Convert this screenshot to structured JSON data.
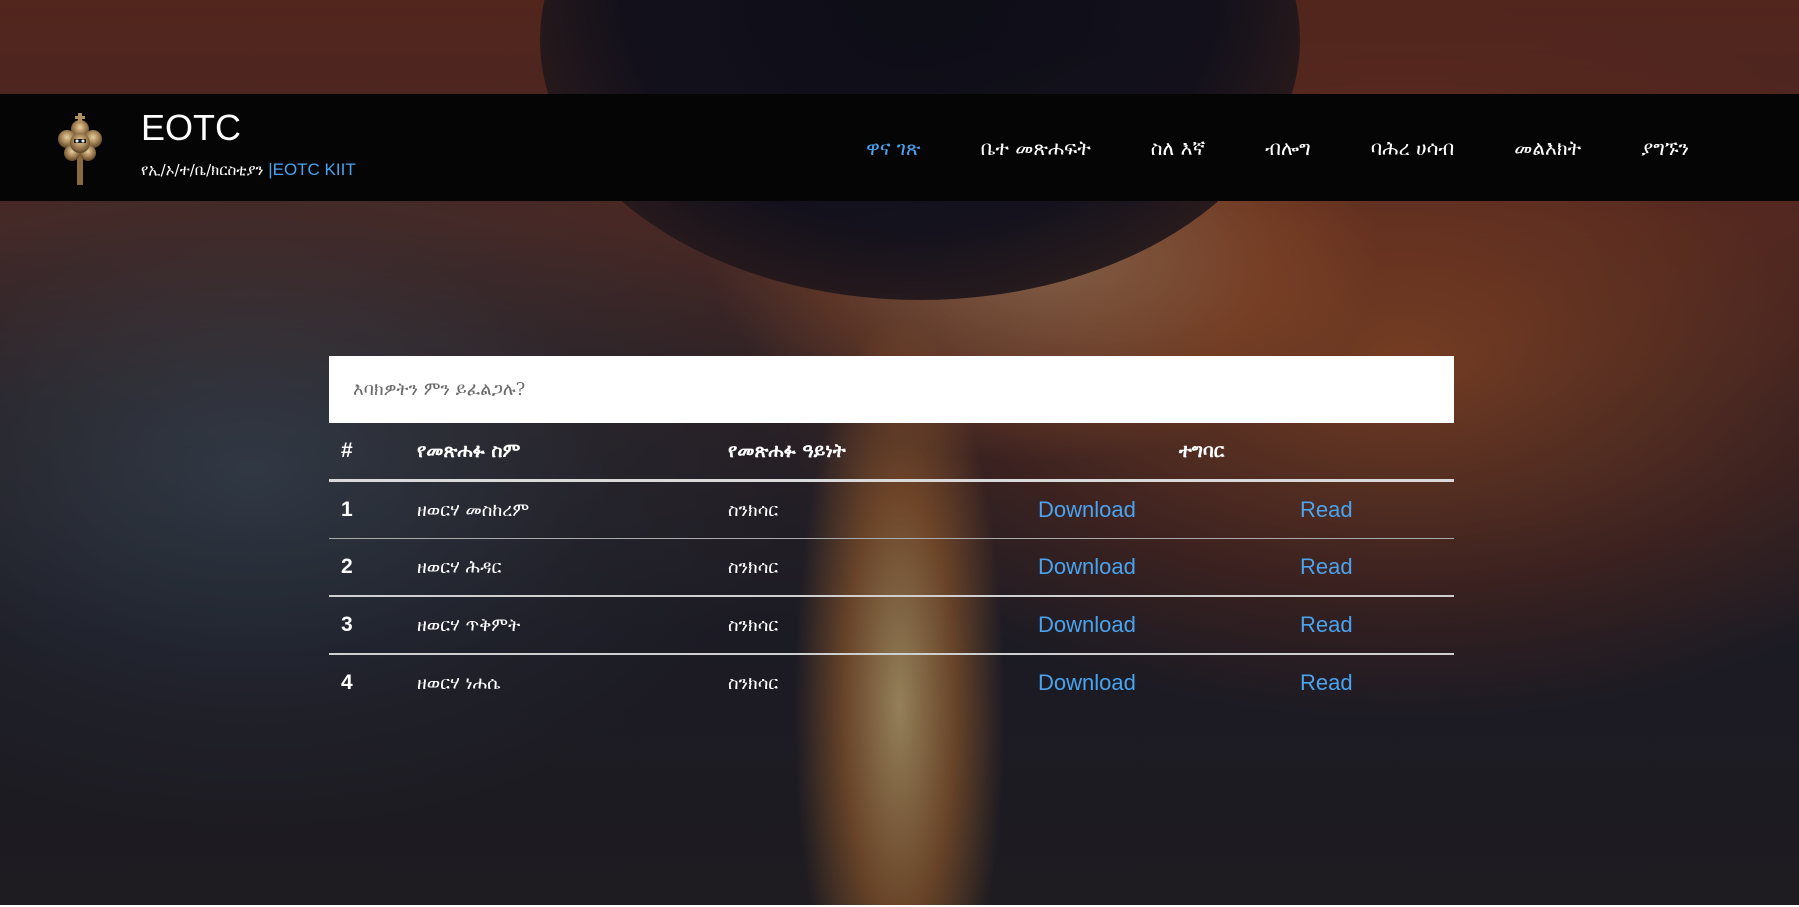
{
  "brand": {
    "title": "EOTC",
    "subtitle": "የኢ/ኦ/ተ/ቤ/ክርስቲያን ",
    "subtitle_accent": "|EOTC KIIT",
    "logo_icon": "cross-tree-icon"
  },
  "nav": {
    "items": [
      {
        "label": "ዋና ገጽ",
        "active": true
      },
      {
        "label": "ቤተ መጽሐፍት",
        "active": false
      },
      {
        "label": "ስለ እኛ",
        "active": false
      },
      {
        "label": "ብሎግ",
        "active": false
      },
      {
        "label": "ባሕረ ሀሳብ",
        "active": false
      },
      {
        "label": "መልእክት",
        "active": false
      },
      {
        "label": "ያግኙን",
        "active": false
      }
    ]
  },
  "search": {
    "placeholder": "እባክዎትን ምን ይፈልጋሉ?",
    "value": ""
  },
  "table": {
    "headers": {
      "num": "#",
      "name": "የመጽሐፉ ስም",
      "type": "የመጽሐፉ ዓይነት",
      "action": "ተግባር"
    },
    "rows": [
      {
        "num": "1",
        "name": "ዘወርሃ መስከረም",
        "type": "ስንክሳር",
        "download": "Download",
        "read": "Read"
      },
      {
        "num": "2",
        "name": "ዘወርሃ ሕዳር",
        "type": "ስንክሳር",
        "download": "Download",
        "read": "Read"
      },
      {
        "num": "3",
        "name": "ዘወርሃ ጥቅምት",
        "type": "ስንክሳር",
        "download": "Download",
        "read": "Read"
      },
      {
        "num": "4",
        "name": "ዘወርሃ ነሐሴ",
        "type": "ስንክሳር",
        "download": "Download",
        "read": "Read"
      }
    ]
  },
  "colors": {
    "accent": "#4aa3ef",
    "header_bg": "#050505",
    "text": "#ffffff"
  }
}
